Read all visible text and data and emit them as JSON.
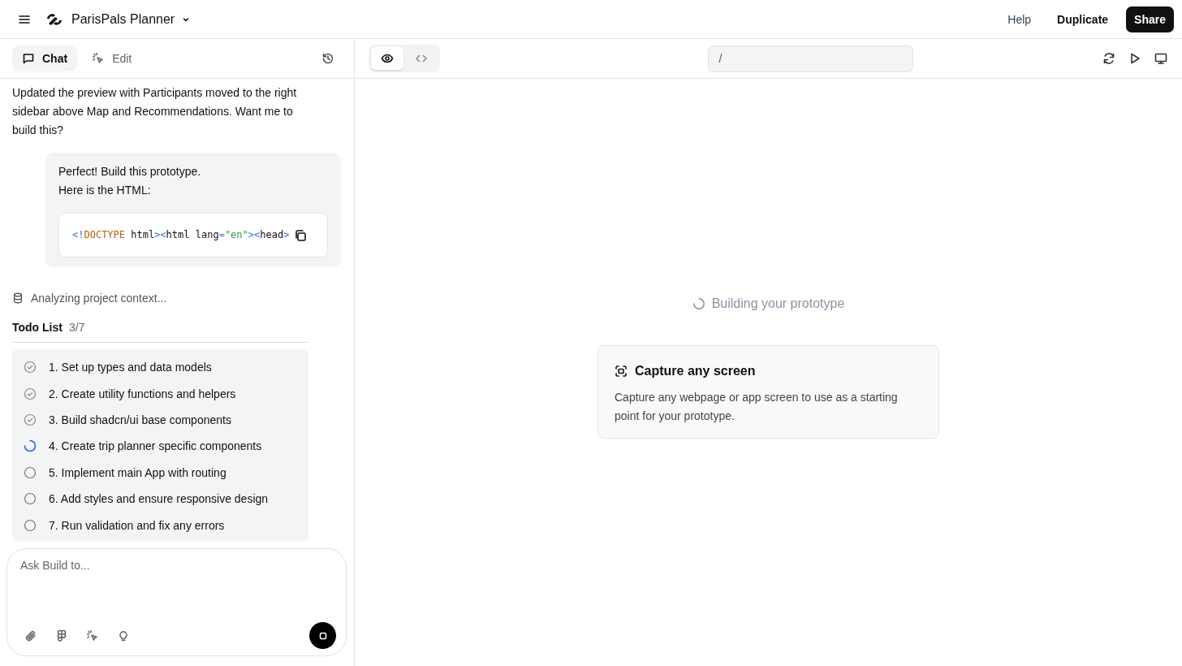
{
  "topbar": {
    "project": "ParisPals Planner",
    "actions": [
      {
        "label": "Help",
        "kind": "link"
      },
      {
        "label": "Duplicate",
        "kind": "plain"
      },
      {
        "label": "Share",
        "kind": "primary"
      }
    ]
  },
  "left_tabs": [
    {
      "label": "Chat",
      "selected": true,
      "kind": "chat"
    },
    {
      "label": "Edit",
      "selected": false,
      "kind": "edit"
    }
  ],
  "chat": {
    "assistant_message": "Updated the preview with Participants moved to the right sidebar above Map and Recommendations. Want me to build this?",
    "user_message": {
      "lines": [
        "Perfect! Build this prototype.",
        "Here is the HTML:"
      ],
      "code": [
        {
          "text": "<!",
          "kind": "punct"
        },
        {
          "text": "DOCTYPE",
          "kind": "keyword"
        },
        {
          "text": " html",
          "kind": "plain"
        },
        {
          "text": "><",
          "kind": "punct"
        },
        {
          "text": "html lang",
          "kind": "plain"
        },
        {
          "text": "=",
          "kind": "punct"
        },
        {
          "text": "\"en\"",
          "kind": "string"
        },
        {
          "text": "><",
          "kind": "punct"
        },
        {
          "text": "head",
          "kind": "plain"
        },
        {
          "text": ">",
          "kind": "punct"
        }
      ]
    },
    "status": "Analyzing project context...",
    "todo": {
      "title": "Todo List",
      "count": "3/7",
      "items": [
        {
          "label": "1. Set up types and data models",
          "kind": "done"
        },
        {
          "label": "2. Create utility functions and helpers",
          "kind": "done"
        },
        {
          "label": "3. Build shadcn/ui base components",
          "kind": "done"
        },
        {
          "label": "4. Create trip planner specific components",
          "kind": "active"
        },
        {
          "label": "5. Implement main App with routing",
          "kind": "pending"
        },
        {
          "label": "6. Add styles and ensure responsive design",
          "kind": "pending"
        },
        {
          "label": "7. Run validation and fix any errors",
          "kind": "pending"
        }
      ]
    }
  },
  "composer": {
    "placeholder": "Ask Build to..."
  },
  "preview": {
    "view_toggle": [
      {
        "kind": "preview",
        "selected": true
      },
      {
        "kind": "code",
        "selected": false
      }
    ],
    "url": "/",
    "loading": "Building your prototype",
    "card": {
      "title": "Capture any screen",
      "text": "Capture any webpage or app screen to use as a starting point for your prototype."
    }
  }
}
